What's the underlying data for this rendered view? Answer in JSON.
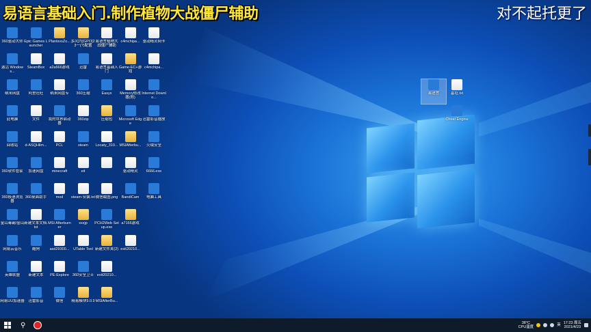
{
  "title_left": "易语言基础入门.制作植物大战僵尸辅助",
  "title_right": "对不起托更了",
  "col0": [
    {
      "label": "360驱动大师",
      "type": "exe"
    },
    {
      "label": "激活 Windows...",
      "type": "exe"
    },
    {
      "label": "纳米网盘",
      "type": "exe"
    },
    {
      "label": "此电脑",
      "type": "exe"
    },
    {
      "label": "回收站",
      "type": "exe"
    },
    {
      "label": "360软件管家",
      "type": "exe"
    },
    {
      "label": "360极速浏览器",
      "type": "exe"
    },
    {
      "label": "金山毒霸/金山",
      "type": "exe"
    },
    {
      "label": "网易云音乐",
      "type": "exe"
    },
    {
      "label": "英雄联盟",
      "type": "exe"
    },
    {
      "label": "网易UU加速器",
      "type": "exe"
    }
  ],
  "col1": [
    {
      "label": "Epic Games Launcher",
      "type": "exe"
    },
    {
      "label": "SteamBox",
      "type": "file"
    },
    {
      "label": "阿里旺旺",
      "type": "exe"
    },
    {
      "label": "文件",
      "type": "file"
    },
    {
      "label": "d-ASQHilm...",
      "type": "file"
    },
    {
      "label": "加速网盘",
      "type": "exe"
    },
    {
      "label": "360桌面助手",
      "type": "exe"
    },
    {
      "label": "新建文本文档.txt",
      "type": "file"
    },
    {
      "label": "酷狗",
      "type": "exe"
    },
    {
      "label": "新建文本",
      "type": "file"
    },
    {
      "label": "迅雷影音",
      "type": "exe"
    }
  ],
  "col2": [
    {
      "label": "PlantsvsZo...",
      "type": "folder"
    },
    {
      "label": "a2a666游戏",
      "type": "file"
    },
    {
      "label": "纳米网盘专",
      "type": "file"
    },
    {
      "label": "我的世界启动器",
      "type": "exe"
    },
    {
      "label": "PCL",
      "type": "file"
    },
    {
      "label": "minecraft",
      "type": "file"
    },
    {
      "label": "mod",
      "type": "file"
    },
    {
      "label": "MSI Afterburner",
      "type": "exe"
    },
    {
      "label": "asd29300...",
      "type": "file"
    },
    {
      "label": "PE-Explore",
      "type": "file"
    },
    {
      "label": "微信",
      "type": "exe"
    }
  ],
  "col3": [
    {
      "label": "[EX]为[GPO]23一(?)配置",
      "type": "folder"
    },
    {
      "label": "迅雷",
      "type": "exe"
    },
    {
      "label": "360压缩",
      "type": "exe"
    },
    {
      "label": "360zip",
      "type": "file"
    },
    {
      "label": "steam",
      "type": "exe"
    },
    {
      "label": "eit",
      "type": "file"
    },
    {
      "label": "steam-安装.txt",
      "type": "file"
    },
    {
      "label": "xxxjp",
      "type": "folder"
    },
    {
      "label": "UTable Tool",
      "type": "file"
    },
    {
      "label": "360安全卫士",
      "type": "exe"
    },
    {
      "label": "精易模块9.0.9",
      "type": "folder"
    }
  ],
  "col4": [
    {
      "label": "易语言植物大战僵尸辅助",
      "type": "file"
    },
    {
      "label": "易语言基础入门",
      "type": "file"
    },
    {
      "label": "Easyx",
      "type": "exe"
    },
    {
      "label": "压缩包",
      "type": "folder"
    },
    {
      "label": "Locaty_310...",
      "type": "file"
    },
    {
      "label": "",
      "type": "file"
    },
    {
      "label": "微信截图.png",
      "type": "file"
    },
    {
      "label": "PCH2Web Setup.exe",
      "type": "exe"
    },
    {
      "label": "新建文件夹(2)",
      "type": "folder"
    },
    {
      "label": "exit20210...",
      "type": "file"
    },
    {
      "label": "MSIAfterBu...",
      "type": "folder"
    }
  ],
  "col5": [
    {
      "label": "c4mchipa...",
      "type": "file"
    },
    {
      "label": "Game-EC+游戏",
      "type": "folder"
    },
    {
      "label": "Memory修改器(附)",
      "type": "file"
    },
    {
      "label": "Microsoft Edge",
      "type": "exe"
    },
    {
      "label": "MSIAfterbu...",
      "type": "folder"
    },
    {
      "label": "驱动精灵",
      "type": "file"
    },
    {
      "label": "BandiCam",
      "type": "exe"
    },
    {
      "label": "a7166游戏",
      "type": "folder"
    },
    {
      "label": "exit20210...",
      "type": "file"
    }
  ],
  "col6": [
    {
      "label": "驱动精灵网卡",
      "type": "file"
    },
    {
      "label": "c4mchipa...",
      "type": "file"
    },
    {
      "label": "Internet Downlo...",
      "type": "exe"
    },
    {
      "label": "迅雷影音播放",
      "type": "exe"
    },
    {
      "label": "火绒安全",
      "type": "exe"
    },
    {
      "label": "6666.exe",
      "type": "exe"
    },
    {
      "label": "电脑工具",
      "type": "exe"
    }
  ],
  "right_icons": [
    {
      "label": "易语言",
      "type": "exe"
    },
    {
      "label": "基址.txt",
      "type": "file"
    },
    {
      "label": "Cheat Engine",
      "type": "exe"
    }
  ],
  "tray": {
    "temp": "38°C",
    "cpu": "CPU温度",
    "time": "17:23 周五",
    "date": "2021/4/23",
    "ime": "英"
  }
}
